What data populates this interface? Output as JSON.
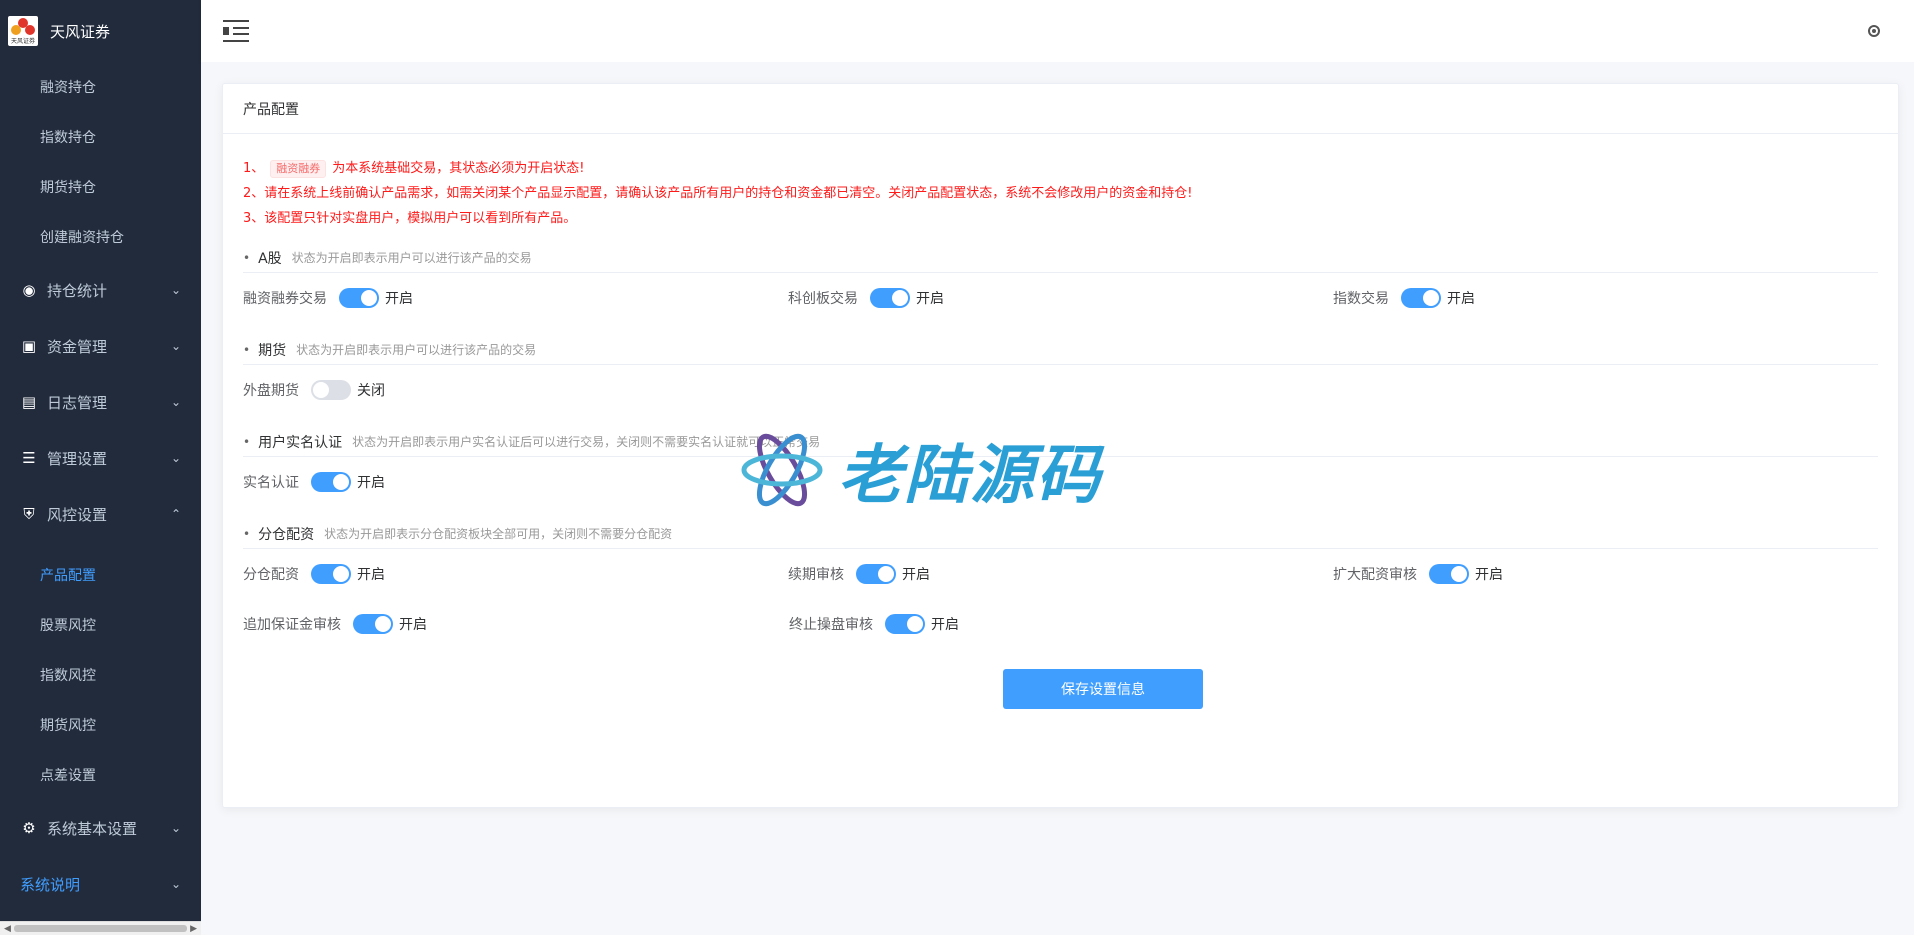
{
  "brand": {
    "name": "天风证券",
    "logo_text": "天风证券"
  },
  "sidebar": {
    "top_subitems": [
      {
        "label": "融资持仓"
      },
      {
        "label": "指数持仓"
      },
      {
        "label": "期货持仓"
      },
      {
        "label": "创建融资持仓"
      }
    ],
    "menus": [
      {
        "label": "持仓统计",
        "icon": "chart-icon"
      },
      {
        "label": "资金管理",
        "icon": "wallet-icon"
      },
      {
        "label": "日志管理",
        "icon": "log-icon"
      },
      {
        "label": "管理设置",
        "icon": "sliders-icon"
      },
      {
        "label": "风控设置",
        "icon": "shield-icon"
      }
    ],
    "risk_subitems": [
      {
        "label": "产品配置",
        "active": true
      },
      {
        "label": "股票风控"
      },
      {
        "label": "指数风控"
      },
      {
        "label": "期货风控"
      },
      {
        "label": "点差设置"
      }
    ],
    "bottom_menus": [
      {
        "label": "系统基本设置",
        "icon": "gear-icon"
      },
      {
        "label": "系统说明"
      }
    ]
  },
  "card": {
    "title": "产品配置",
    "notices": {
      "n1_prefix": "1、",
      "n1_tag": "融资融券",
      "n1_text": "为本系统基础交易，其状态必须为开启状态!",
      "n2": "2、请在系统上线前确认产品需求，如需关闭某个产品显示配置，请确认该产品所有用户的持仓和资金都已清空。关闭产品配置状态，系统不会修改用户的资金和持仓!",
      "n3": "3、该配置只针对实盘用户，模拟用户可以看到所有产品。"
    },
    "sections": [
      {
        "title": "A股",
        "desc": "状态为开启即表示用户可以进行该产品的交易",
        "fields": [
          {
            "label": "融资融券交易",
            "on": true,
            "state": "开启"
          },
          {
            "label": "科创板交易",
            "on": true,
            "state": "开启"
          },
          {
            "label": "指数交易",
            "on": true,
            "state": "开启"
          }
        ]
      },
      {
        "title": "期货",
        "desc": "状态为开启即表示用户可以进行该产品的交易",
        "fields": [
          {
            "label": "外盘期货",
            "on": false,
            "state": "关闭"
          }
        ]
      },
      {
        "title": "用户实名认证",
        "desc": "状态为开启即表示用户实名认证后可以进行交易，关闭则不需要实名认证就可以正常交易",
        "fields": [
          {
            "label": "实名认证",
            "on": true,
            "state": "开启"
          }
        ]
      },
      {
        "title": "分仓配资",
        "desc": "状态为开启即表示分仓配资板块全部可用，关闭则不需要分仓配资",
        "fields": [
          {
            "label": "分仓配资",
            "on": true,
            "state": "开启"
          },
          {
            "label": "续期审核",
            "on": true,
            "state": "开启"
          },
          {
            "label": "扩大配资审核",
            "on": true,
            "state": "开启"
          },
          {
            "label": "追加保证金审核",
            "on": true,
            "state": "开启"
          },
          {
            "label": "终止操盘审核",
            "on": true,
            "state": "开启"
          }
        ]
      }
    ],
    "save_label": "保存设置信息"
  },
  "watermark": {
    "text": "老陆源码"
  },
  "colors": {
    "sidebar_bg": "#222b3c",
    "accent": "#409eff",
    "notice": "#ff1a1a"
  }
}
